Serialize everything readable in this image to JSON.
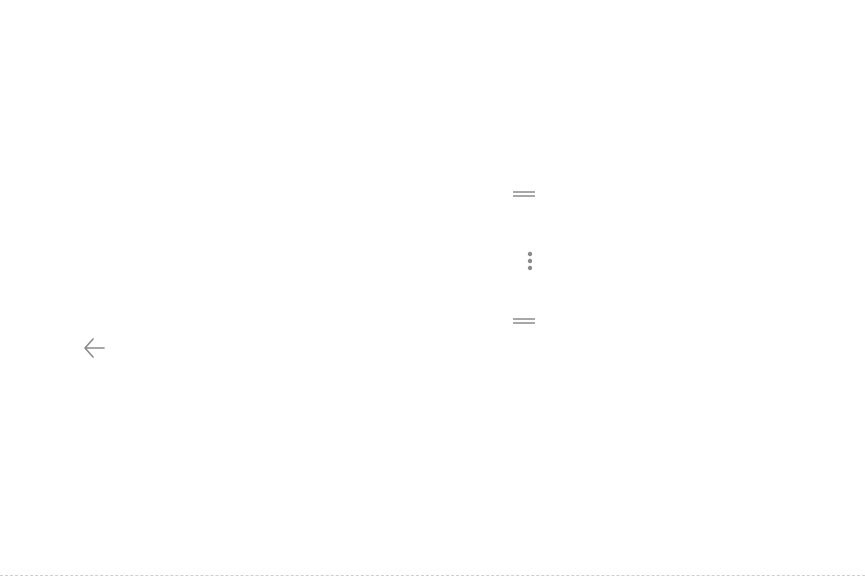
{
  "icons": [
    {
      "name": "back-arrow-icon",
      "glyph": "arrow-left"
    },
    {
      "name": "drag-handle-icon",
      "glyph": "two-horizontal-lines"
    },
    {
      "name": "more-vertical-icon",
      "glyph": "three-vertical-dots"
    },
    {
      "name": "drag-handle-icon",
      "glyph": "two-horizontal-lines"
    }
  ],
  "colors": {
    "background": "#ffffff",
    "icon": "#8a8a8a",
    "rule": "#cfcfcf"
  }
}
